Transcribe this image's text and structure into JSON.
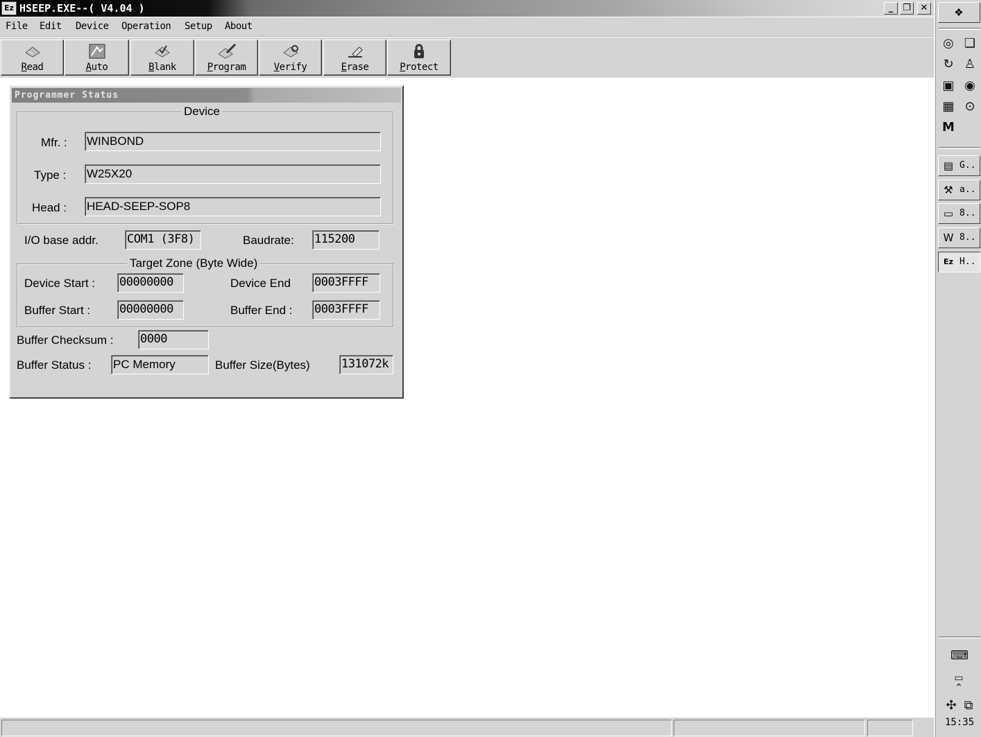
{
  "window": {
    "title": "HSEEP.EXE--( V4.04 )",
    "icon": "app-logo-icon",
    "minimize_glyph": "_",
    "restore_glyph": "❐",
    "close_glyph": "✕"
  },
  "menu": [
    "File",
    "Edit",
    "Device",
    "Operation",
    "Setup",
    "About"
  ],
  "toolbar": {
    "read": "Read",
    "auto": "Auto",
    "blank": "Blank",
    "program": "Program",
    "verify": "Verify",
    "erase": "Erase",
    "protect": "Protect"
  },
  "status_window": {
    "title": "Programmer Status",
    "device_group": "Device",
    "mfr_label": "Mfr. :",
    "mfr_value": "WINBOND",
    "type_label": "Type :",
    "type_value": "W25X20",
    "head_label": "Head :",
    "head_value": "HEAD-SEEP-SOP8",
    "io_label": "I/O base addr.",
    "io_value": "COM1 (3F8)",
    "baud_label": "Baudrate:",
    "baud_value": "115200",
    "target_group": "Target Zone (Byte Wide)",
    "device_start_label": "Device Start :",
    "device_start_value": "00000000",
    "device_end_label": "Device End",
    "device_end_value": "0003FFFF",
    "buffer_start_label": "Buffer Start :",
    "buffer_start_value": "00000000",
    "buffer_end_label": "Buffer End :",
    "buffer_end_value": "0003FFFF",
    "checksum_label": "Buffer Checksum :",
    "checksum_value": "0000",
    "buffer_status_label": "Buffer Status :",
    "buffer_status_value": "PC Memory",
    "buffer_size_label": "Buffer Size(Bytes)",
    "buffer_size_value": "131072k"
  },
  "taskbar": {
    "tasks": [
      {
        "label": "G..",
        "icon": "calendar-icon"
      },
      {
        "label": "a..",
        "icon": "tool-icon"
      },
      {
        "label": "8..",
        "icon": "folder-icon"
      },
      {
        "label": "8..",
        "icon": "word-document-icon"
      },
      {
        "label": "H..",
        "icon": "app-logo-icon"
      }
    ],
    "clock": "15:35"
  }
}
